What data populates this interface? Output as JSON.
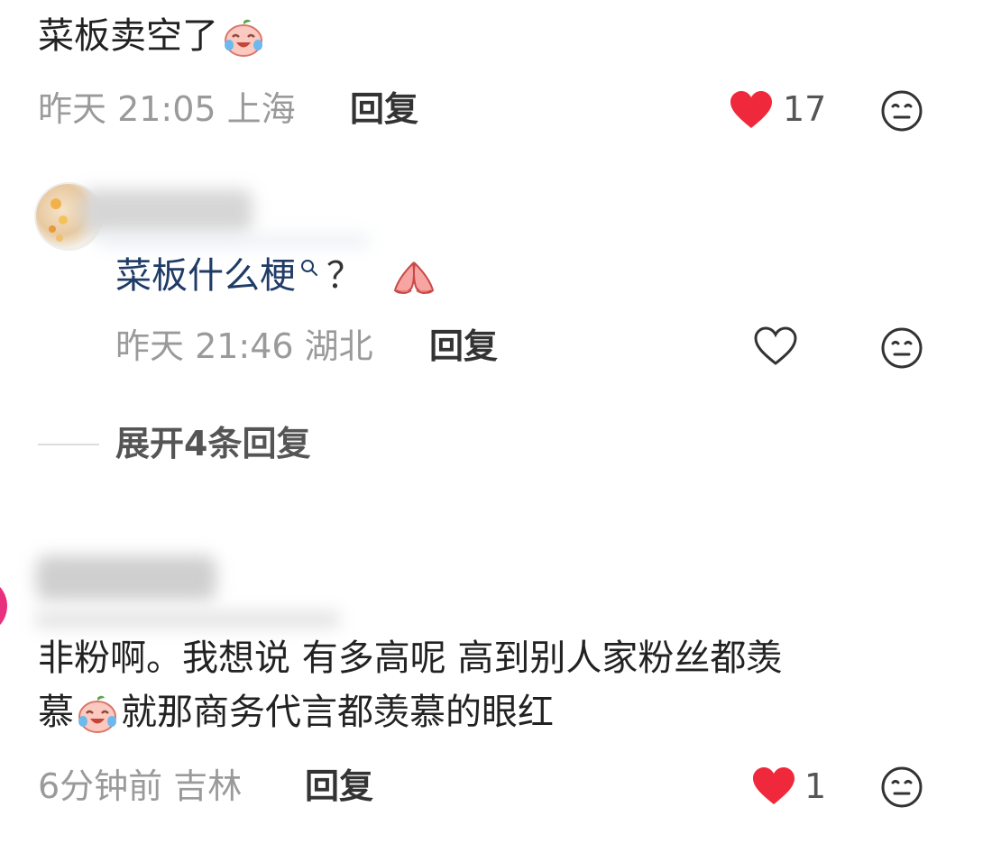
{
  "comments": [
    {
      "text_before": "菜板卖空了",
      "emoji": "crying-laughing-peach",
      "meta": "昨天 21:05 上海",
      "reply_label": "回复",
      "likes": "17",
      "liked": true
    },
    {
      "author": "",
      "text": "菜板什么梗",
      "search_icon": "search-superscript-icon",
      "text_after": "？",
      "emoji": "praying-hands",
      "meta": "昨天 21:46 湖北",
      "reply_label": "回复",
      "liked": false,
      "expand_label": "展开4条回复"
    },
    {
      "author": "",
      "text_line1": "非粉啊。我想说 有多高呢 高到别人家粉丝都羡",
      "text_line2_before": "慕",
      "emoji": "crying-laughing-peach",
      "text_line2_after": "就那商务代言都羡慕的眼红",
      "meta": "6分钟前 吉林",
      "reply_label": "回复",
      "likes": "1",
      "liked": true
    }
  ],
  "colors": {
    "like_red": "#f0283c",
    "meta_gray": "#9a9a9a",
    "reply_text_blue": "#1f3b66"
  }
}
